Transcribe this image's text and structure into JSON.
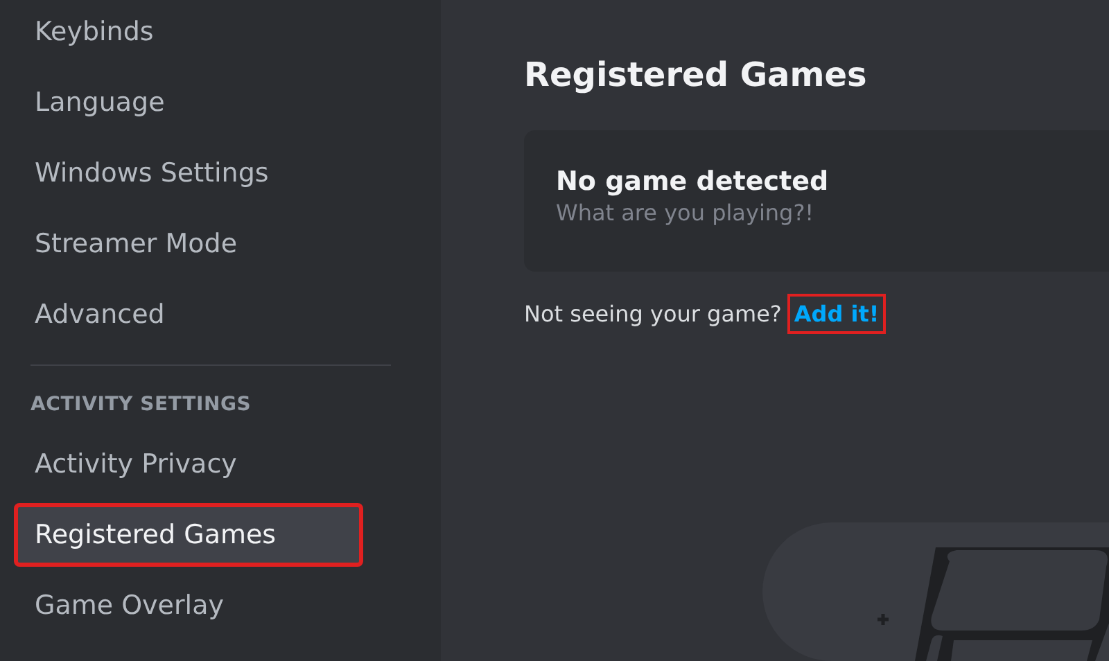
{
  "sidebar": {
    "items": [
      {
        "kind": "item",
        "label": "Keybinds",
        "selected": false,
        "highlighted": false
      },
      {
        "kind": "item",
        "label": "Language",
        "selected": false,
        "highlighted": false
      },
      {
        "kind": "item",
        "label": "Windows Settings",
        "selected": false,
        "highlighted": false
      },
      {
        "kind": "item",
        "label": "Streamer Mode",
        "selected": false,
        "highlighted": false
      },
      {
        "kind": "item",
        "label": "Advanced",
        "selected": false,
        "highlighted": false
      },
      {
        "kind": "divider"
      },
      {
        "kind": "header",
        "label": "ACTIVITY SETTINGS"
      },
      {
        "kind": "item",
        "label": "Activity Privacy",
        "selected": false,
        "highlighted": false
      },
      {
        "kind": "item",
        "label": "Registered Games",
        "selected": true,
        "highlighted": true
      },
      {
        "kind": "item",
        "label": "Game Overlay",
        "selected": false,
        "highlighted": false
      }
    ]
  },
  "main": {
    "title": "Registered Games",
    "card": {
      "title": "No game detected",
      "subtitle": "What are you playing?!"
    },
    "prompt": {
      "text": "Not seeing your game?",
      "link": "Add it!",
      "link_highlighted": true
    }
  }
}
